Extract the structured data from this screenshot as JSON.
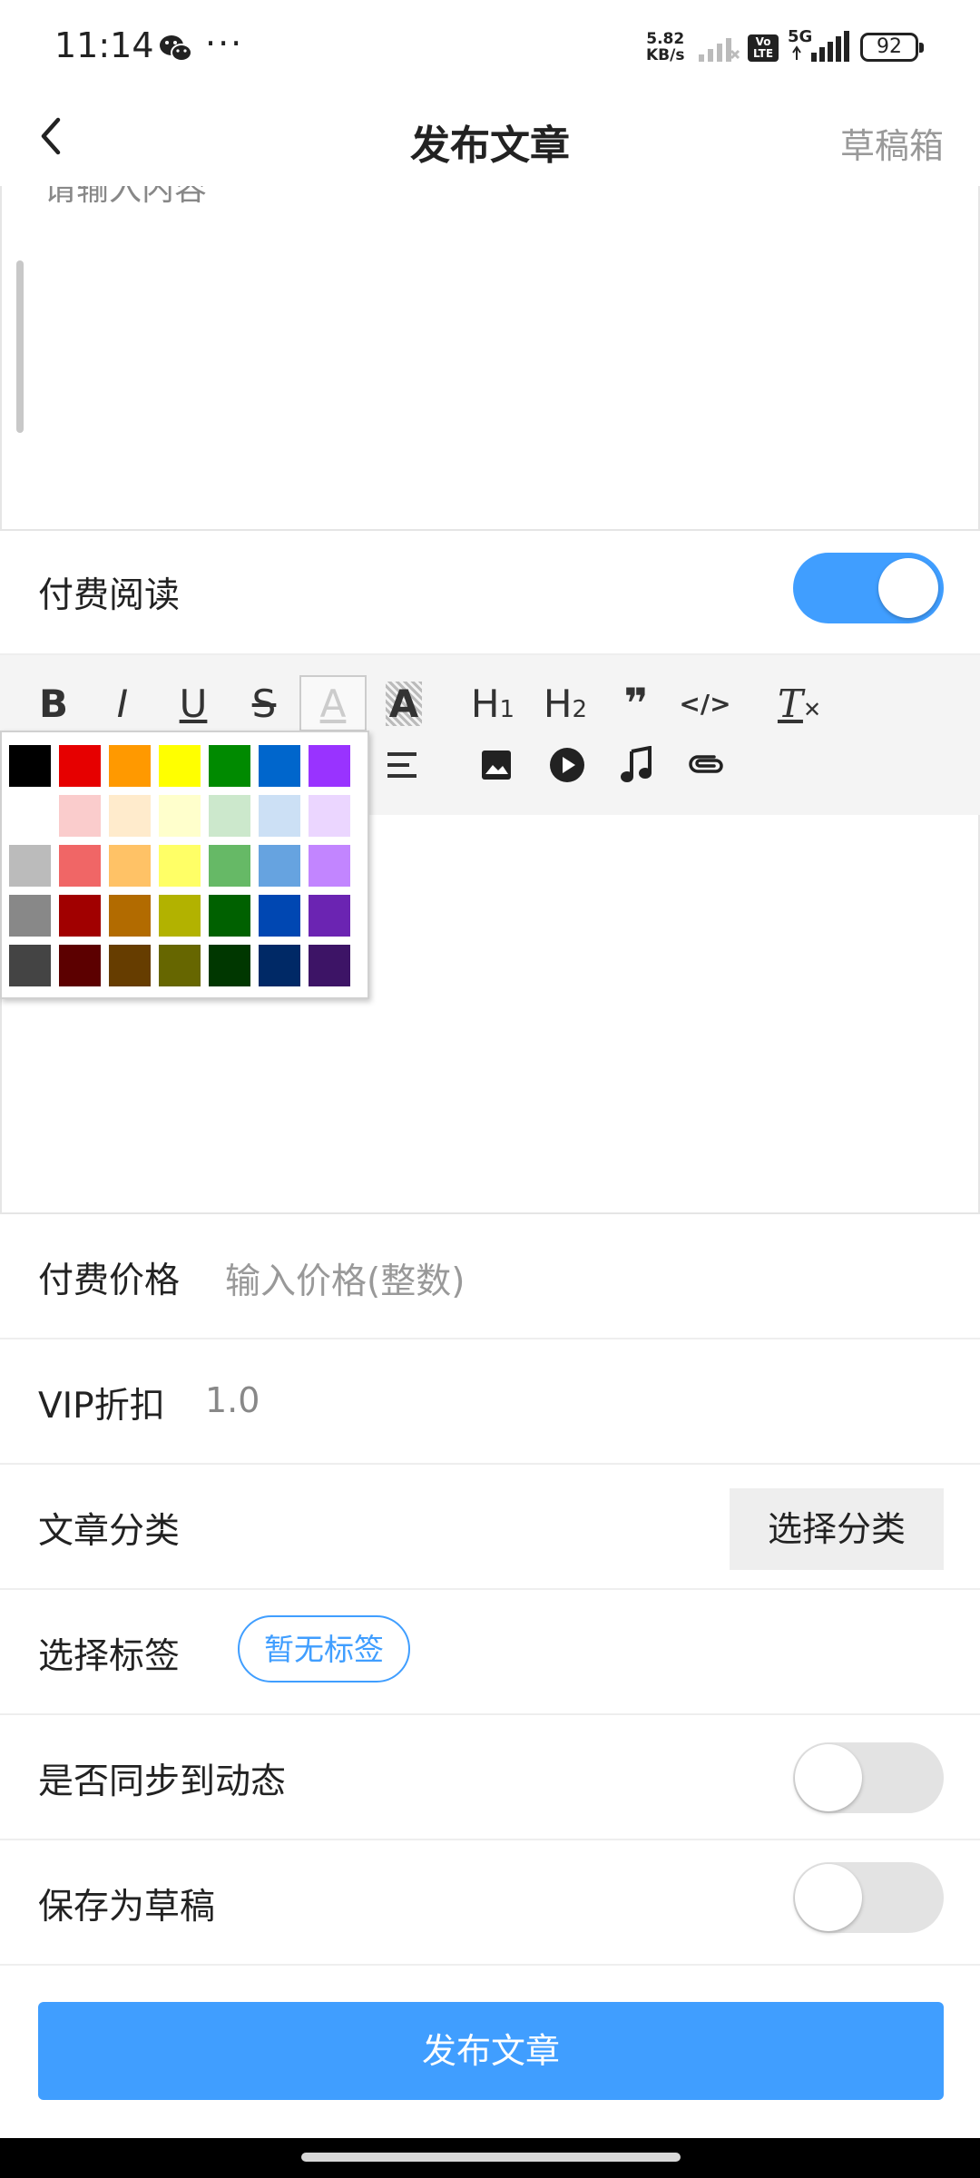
{
  "status_bar": {
    "time": "11:14",
    "more": "···",
    "speed_value": "5.82",
    "speed_unit": "KB/s",
    "volte_line1": "Vo",
    "volte_line2": "LTE",
    "network": "5G",
    "battery": "92"
  },
  "header": {
    "title": "发布文章",
    "drafts_label": "草稿箱"
  },
  "editor1": {
    "placeholder": "请输入内容"
  },
  "paid_reading": {
    "label": "付费阅读",
    "enabled": true
  },
  "toolbar": {
    "bold": "B",
    "italic": "I",
    "underline": "U",
    "strike": "S",
    "font_color": "A",
    "bg_color": "A",
    "h1": "H",
    "h1_sub": "1",
    "h2": "H",
    "h2_sub": "2",
    "quote": "❞",
    "code": "</>",
    "clear_format": "T"
  },
  "color_picker": {
    "rows": [
      [
        "#000000",
        "#e60000",
        "#ff9900",
        "#ffff00",
        "#008a00",
        "#0066cc",
        "#9933ff"
      ],
      [
        "#ffffff",
        "#facccc",
        "#ffebcc",
        "#ffffcc",
        "#cce8cc",
        "#cce0f5",
        "#ebd6ff"
      ],
      [
        "#bbbbbb",
        "#f06666",
        "#ffc266",
        "#ffff66",
        "#66b966",
        "#66a3e0",
        "#c285ff"
      ],
      [
        "#888888",
        "#a10000",
        "#b26b00",
        "#b2b200",
        "#006100",
        "#0047b2",
        "#6b24b2"
      ],
      [
        "#444444",
        "#5c0000",
        "#663d00",
        "#666600",
        "#003700",
        "#002966",
        "#3d1466"
      ]
    ]
  },
  "paid_price": {
    "label": "付费价格",
    "placeholder": "输入价格(整数)"
  },
  "vip_discount": {
    "label": "VIP折扣",
    "value": "1.0"
  },
  "category": {
    "label": "文章分类",
    "button": "选择分类"
  },
  "tags": {
    "label": "选择标签",
    "chip": "暂无标签"
  },
  "sync_dynamic": {
    "label": "是否同步到动态",
    "enabled": false
  },
  "save_draft": {
    "label": "保存为草稿",
    "enabled": false
  },
  "publish_button": "发布文章",
  "colors": {
    "accent": "#409eff",
    "toolbar_bg": "#f4f4f4",
    "muted_text": "#999999"
  }
}
